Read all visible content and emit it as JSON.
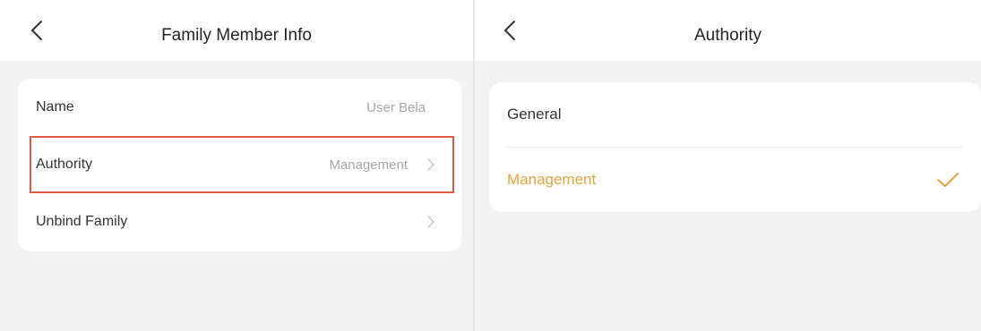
{
  "left_screen": {
    "title": "Family Member Info",
    "rows": [
      {
        "label": "Name",
        "value": "User Bela"
      },
      {
        "label": "Authority",
        "value": "Management"
      },
      {
        "label": "Unbind Family",
        "value": ""
      }
    ]
  },
  "right_screen": {
    "title": "Authority",
    "options": [
      {
        "label": "General",
        "selected": false
      },
      {
        "label": "Management",
        "selected": true
      }
    ]
  },
  "colors": {
    "accent": "#e2a43c",
    "highlight_border": "#e25b45",
    "background": "#f2f2f2"
  },
  "icons": [
    "back-arrow-icon",
    "chevron-right-icon",
    "checkmark-icon"
  ]
}
